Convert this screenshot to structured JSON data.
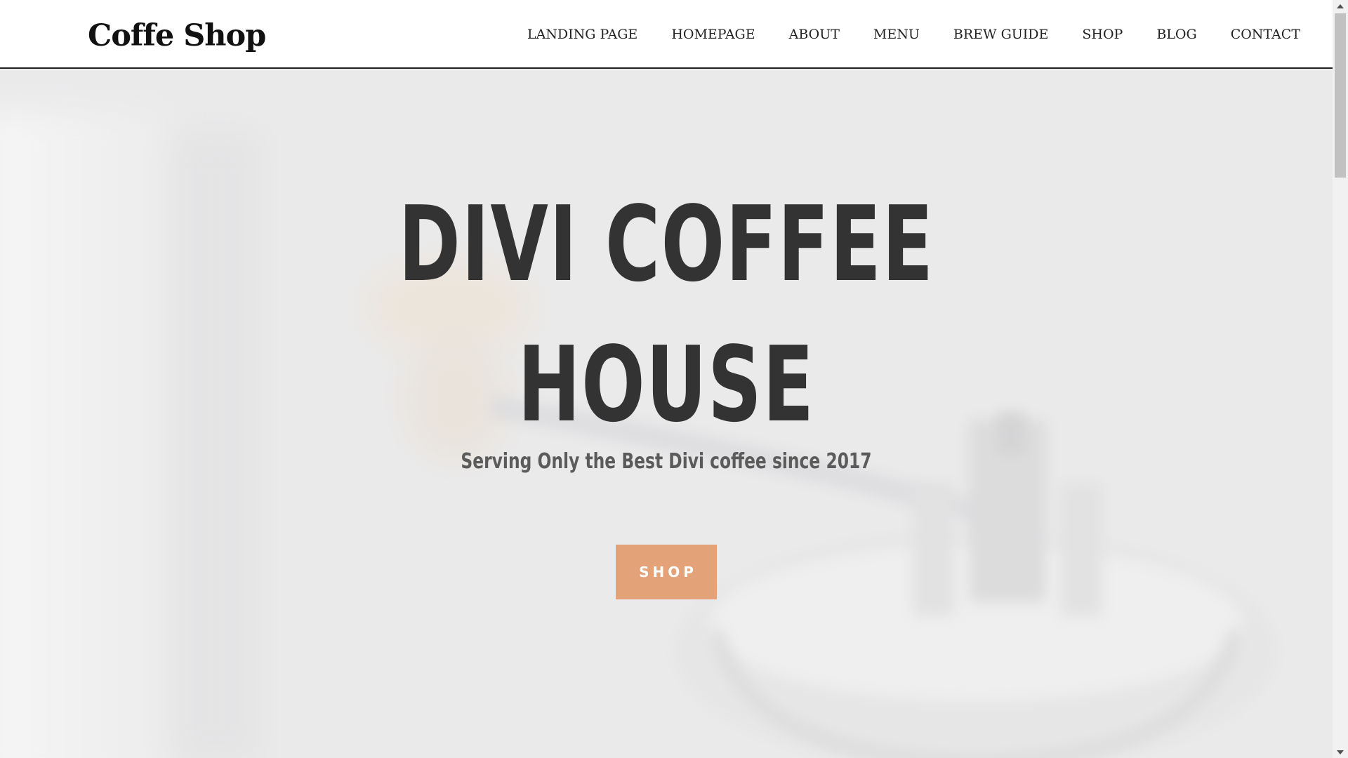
{
  "header": {
    "logo": "Coffe Shop",
    "nav": [
      {
        "label": "LANDING PAGE"
      },
      {
        "label": "HOMEPAGE"
      },
      {
        "label": "ABOUT"
      },
      {
        "label": "MENU"
      },
      {
        "label": "BREW GUIDE"
      },
      {
        "label": "SHOP"
      },
      {
        "label": "BLOG"
      },
      {
        "label": "CONTACT"
      }
    ]
  },
  "hero": {
    "title_line1": "DIVI COFFEE",
    "title_line2": "HOUSE",
    "subtitle": "Serving Only the Best Divi coffee since 2017",
    "button_label": "SHOP",
    "background_image": "blurred-coffee-grinder-image"
  },
  "colors": {
    "accent": "#e3a277",
    "title": "#333333",
    "subtitle": "#5b5b5b",
    "hero_background": "#ebebec"
  },
  "icons": {
    "scroll_up": "scroll-up-arrow-icon",
    "scroll_down": "scroll-down-arrow-icon"
  }
}
